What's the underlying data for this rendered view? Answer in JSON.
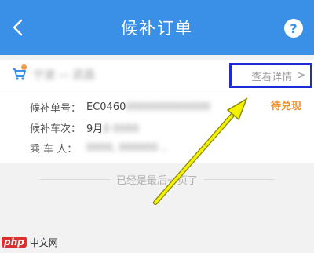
{
  "header": {
    "title": "候补订单",
    "help_label": "?"
  },
  "card": {
    "route_name": "宁波 — 武昌",
    "detail_link": "查看详情",
    "detail_chevron": ">",
    "status": "待兑现",
    "rows": [
      {
        "label": "候补单号：",
        "value_visible": "EC0460",
        "value_blurred": "0000000000000"
      },
      {
        "label": "候补车次：",
        "value_visible": "9月",
        "value_blurred": "0 0000"
      },
      {
        "label": "乘 车 人：",
        "value_visible": "",
        "value_blurred": "0000, 000000 .."
      }
    ]
  },
  "end_text": "已经是最后一页了",
  "watermark": {
    "logo": "php",
    "text": "中文网"
  },
  "colors": {
    "header": "#3a8fe6",
    "status": "#f08c2a",
    "highlight_box": "#1f2bd6",
    "arrow": "#f3f000"
  }
}
